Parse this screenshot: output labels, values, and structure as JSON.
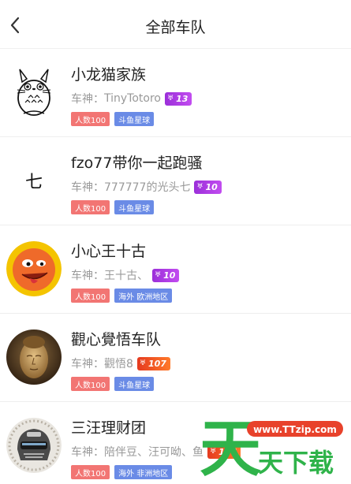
{
  "header": {
    "title": "全部车队",
    "back_icon": "chevron-left-icon"
  },
  "teams": [
    {
      "name": "小龙猫家族",
      "owner_prefix": "车神：",
      "owner": "TinyTotoro",
      "level": "13",
      "level_color": "#a93ce3",
      "tags": [
        {
          "text": "人数100",
          "color": "#f27573"
        },
        {
          "text": "斗鱼星球",
          "color": "#6a8be6"
        }
      ],
      "avatar": "totoro-avatar"
    },
    {
      "name": "fzo77带你一起跑骚",
      "owner_prefix": "车神：",
      "owner": "777777的光头七",
      "level": "10",
      "level_color": "#a93ce3",
      "tags": [
        {
          "text": "人数100",
          "color": "#f27573"
        },
        {
          "text": "斗鱼星球",
          "color": "#6a8be6"
        }
      ],
      "avatar": "qi-text-avatar",
      "avatar_text": "七"
    },
    {
      "name": "小心王十古",
      "owner_prefix": "车神：",
      "owner": "王十古、",
      "level": "10",
      "level_color": "#a93ce3",
      "tags": [
        {
          "text": "人数100",
          "color": "#f27573"
        },
        {
          "text": "海外 欧洲地区",
          "color": "#6a8be6"
        }
      ],
      "avatar": "cartoon-face-avatar"
    },
    {
      "name": "觀心覺悟车队",
      "owner_prefix": "车神：",
      "owner": "觀悟8",
      "level": "107",
      "level_color": "#ef5a26",
      "tags": [
        {
          "text": "人数100",
          "color": "#f27573"
        },
        {
          "text": "斗鱼星球",
          "color": "#6a8be6"
        }
      ],
      "avatar": "buddha-avatar"
    },
    {
      "name": "三汪理财团",
      "owner_prefix": "车神：",
      "owner": "陪伴豆、汪可呦、鱼",
      "level": "106",
      "level_color": "#ef5a26",
      "tags": [
        {
          "text": "人数100",
          "color": "#f27573"
        },
        {
          "text": "海外 非洲地区",
          "color": "#6a8be6"
        }
      ],
      "avatar": "helmet-avatar"
    }
  ],
  "watermark": {
    "url": "www.TTzip.com",
    "text": "天下载",
    "logo_char": "天"
  }
}
